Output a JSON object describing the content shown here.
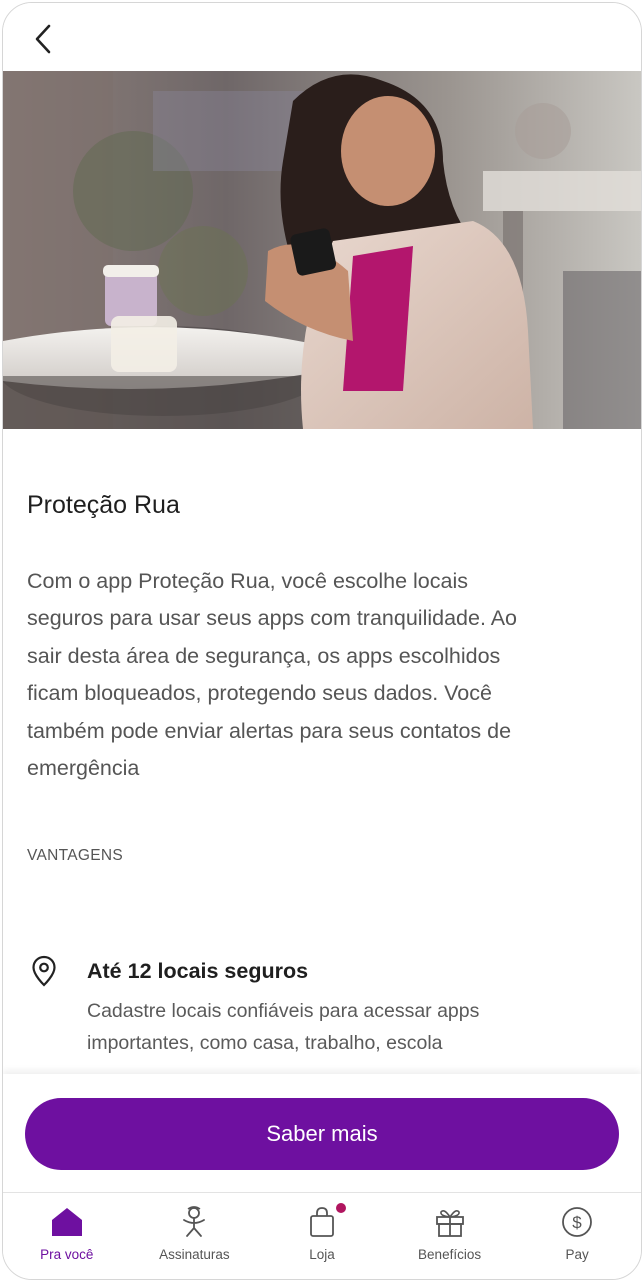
{
  "header": {
    "back_icon": "chevron-left-icon"
  },
  "hero": {
    "alt": "Mulher sorrindo usando o celular em um café"
  },
  "content": {
    "title": "Proteção Rua",
    "description_lines": [
      "Com o app Proteção Rua, você escolhe locais",
      "seguros para usar seus apps com tranquilidade. Ao",
      "sair desta área de segurança, os apps escolhidos",
      "ficam bloqueados, protegendo seus dados. Você",
      "também pode enviar alertas para seus contatos de",
      "emergência"
    ],
    "section_label": "VANTAGENS",
    "benefits": [
      {
        "icon": "location-pin-icon",
        "title": "Até 12 locais seguros",
        "description_lines": [
          "Cadastre locais confiáveis para acessar apps",
          "importantes, como casa, trabalho, escola"
        ]
      }
    ]
  },
  "cta": {
    "label": "Saber mais"
  },
  "bottom_nav": {
    "items": [
      {
        "label": "Pra você",
        "icon": "home-icon",
        "active": true
      },
      {
        "label": "Assinaturas",
        "icon": "gift-person-icon",
        "active": false
      },
      {
        "label": "Loja",
        "icon": "shopping-bag-icon",
        "active": false,
        "badge": true
      },
      {
        "label": "Benefícios",
        "icon": "gift-icon",
        "active": false
      },
      {
        "label": "Pay",
        "icon": "dollar-circle-icon",
        "active": false
      }
    ]
  },
  "colors": {
    "brand_purple": "#6e10a0",
    "badge": "#b0155f",
    "text_primary": "#1f1f1f",
    "text_secondary": "#555555"
  }
}
